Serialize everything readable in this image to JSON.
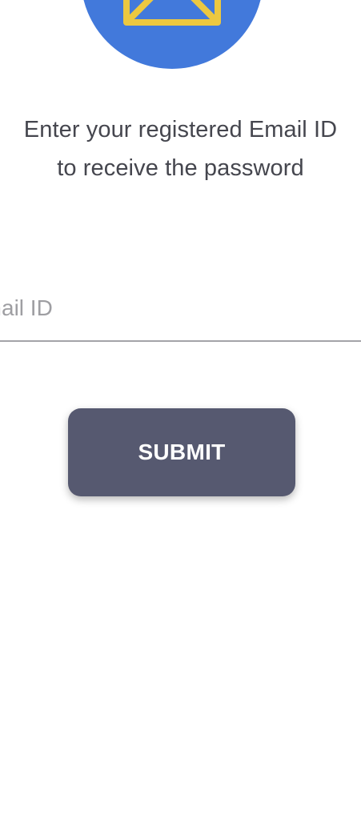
{
  "header": {
    "icon": "mail-icon",
    "circle_color": "#4279db",
    "icon_color": "#ecc840"
  },
  "instruction": {
    "line1": "Enter your registered Email ID",
    "line2": "to receive the password"
  },
  "email": {
    "placeholder": "Email ID",
    "value": ""
  },
  "submit": {
    "label": "SUBMIT",
    "color": "#565970"
  }
}
